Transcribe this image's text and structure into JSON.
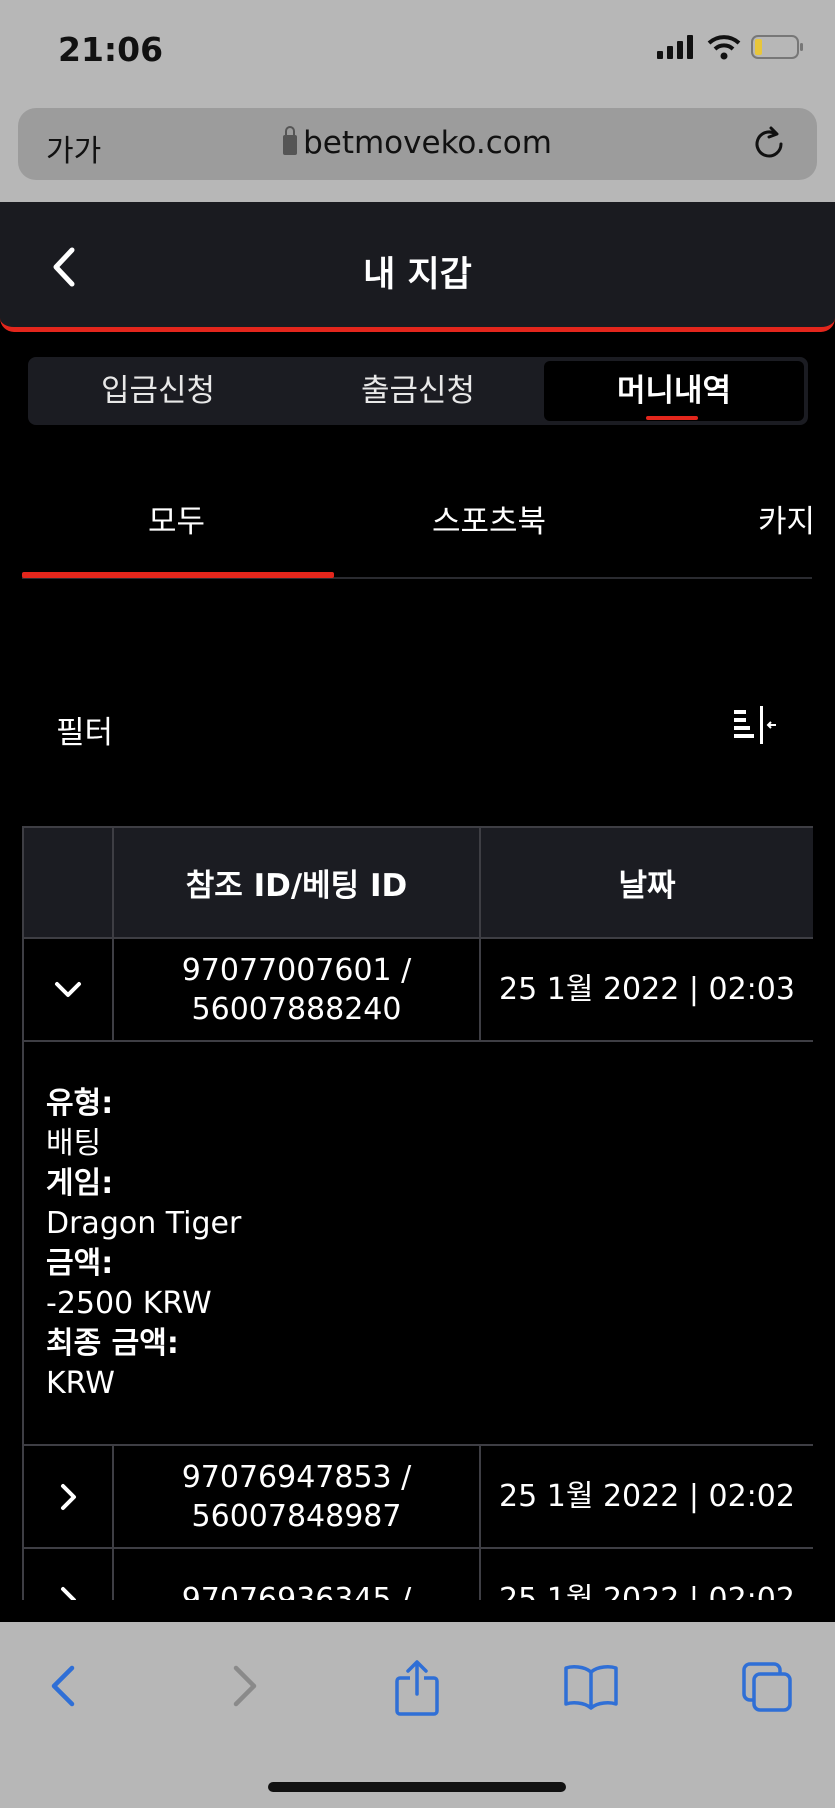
{
  "status": {
    "time": "21:06"
  },
  "browser": {
    "aa_label": "가가",
    "url": "betmoveko.com"
  },
  "header": {
    "title": "내 지갑"
  },
  "wallet_tabs": [
    {
      "label": "입금신청",
      "active": false
    },
    {
      "label": "출금신청",
      "active": false
    },
    {
      "label": "머니내역",
      "active": true
    }
  ],
  "category_tabs": [
    {
      "label": "모두",
      "active": true
    },
    {
      "label": "스포츠북",
      "active": false
    },
    {
      "label": "카지",
      "active": false
    }
  ],
  "filter": {
    "label": "필터"
  },
  "table": {
    "headers": [
      "",
      "참조 ID/베팅 ID",
      "날짜"
    ],
    "rows": [
      {
        "ref_id": "97077007601 /",
        "bet_id": "56007888240",
        "date": "25 1월 2022 | 02:03",
        "expanded": true
      },
      {
        "ref_id": "97076947853 /",
        "bet_id": "56007848987",
        "date": "25 1월 2022 | 02:02",
        "expanded": false
      },
      {
        "ref_id": "97076936345 /",
        "bet_id": "",
        "date": "25 1월 2022 | 02:02",
        "expanded": false
      }
    ],
    "detail": {
      "type_label": "유형:",
      "type_value": "배팅",
      "game_label": "게임:",
      "game_value": "Dragon Tiger",
      "amount_label": "금액:",
      "amount_value": "-2500 KRW",
      "final_label": "최종 금액:",
      "final_value": "KRW"
    }
  },
  "colors": {
    "accent": "#e3261c",
    "panel": "#1b1c22",
    "background": "#000000",
    "ios_blue": "#2f6fd6"
  }
}
